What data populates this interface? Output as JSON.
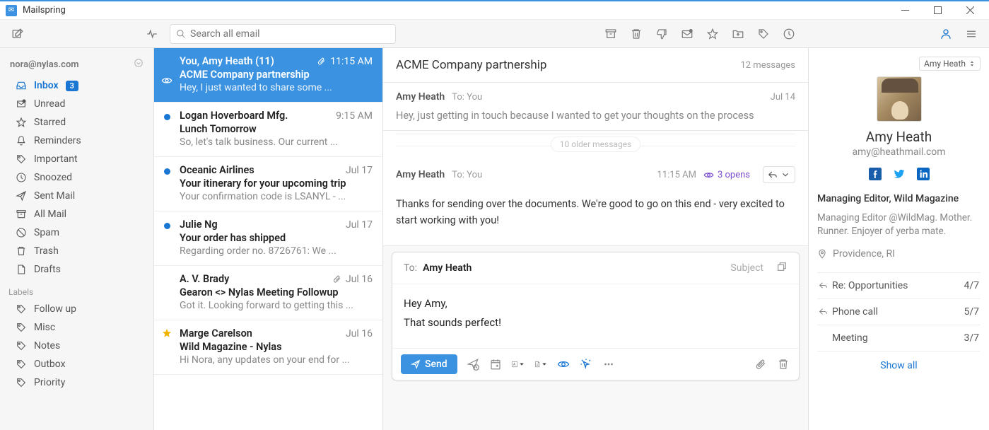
{
  "app": {
    "title": "Mailspring"
  },
  "toolbar": {
    "search_placeholder": "Search all email"
  },
  "sidebar": {
    "account": "nora@nylas.com",
    "inbox": {
      "label": "Inbox",
      "count": "3"
    },
    "items": [
      {
        "label": "Unread"
      },
      {
        "label": "Starred"
      },
      {
        "label": "Reminders"
      },
      {
        "label": "Important"
      },
      {
        "label": "Snoozed"
      },
      {
        "label": "Sent Mail"
      },
      {
        "label": "All Mail"
      },
      {
        "label": "Spam"
      },
      {
        "label": "Trash"
      },
      {
        "label": "Drafts"
      }
    ],
    "labels_header": "Labels",
    "labels": [
      {
        "label": "Follow up"
      },
      {
        "label": "Misc"
      },
      {
        "label": "Notes"
      },
      {
        "label": "Outbox"
      },
      {
        "label": "Priority"
      }
    ]
  },
  "messages": [
    {
      "from": "You, Amy Heath (11)",
      "time": "11:15 AM",
      "subject": "ACME Company partnership",
      "preview": "Hey, I just wanted to share some ...",
      "selected": true,
      "attach": true
    },
    {
      "from": "Logan Hoverboard Mfg.",
      "time": "9:15 AM",
      "subject": "Lunch Tomorrow",
      "preview": "So, let's talk business. Our current ...",
      "unread": true
    },
    {
      "from": "Oceanic Airlines",
      "time": "Jul 17",
      "subject": "Your itinerary for your upcoming trip",
      "preview": "Your confirmation code is LSANYL - ...",
      "unread": true
    },
    {
      "from": "Julie Ng",
      "time": "Jul 17",
      "subject": "Your order has shipped",
      "preview": "Regarding order no. 8726761: We ...",
      "unread": true
    },
    {
      "from": "A. V. Brady",
      "time": "Jul 16",
      "subject": "Gearon <> Nylas Meeting Followup",
      "preview": "Got it. Looking forward to getting this ...",
      "attach": true
    },
    {
      "from": "Marge Carelson",
      "time": "Jul 16",
      "subject": "Wild Magazine - Nylas",
      "preview": "Hi Nora, any updates on your end for ...",
      "star": true
    }
  ],
  "reader": {
    "subject": "ACME Company partnership",
    "count": "12 messages",
    "collapsed": {
      "sender": "Amy Heath",
      "to": "To:",
      "you": "You",
      "date": "Jul 14",
      "body": "Hey, just getting in touch because I wanted to get your thoughts on the process"
    },
    "older": "10 older messages",
    "full": {
      "sender": "Amy Heath",
      "to": "To:",
      "you": "You",
      "date": "11:15 AM",
      "opens": "3 opens",
      "body": "Thanks for sending over the documents. We're good to go on this end - very excited to start working with you!"
    }
  },
  "composer": {
    "to_label": "To:",
    "recipient": "Amy Heath",
    "subject_hint": "Subject",
    "body_line1": "Hey Amy,",
    "body_line2": "That sounds perfect!",
    "send": "Send"
  },
  "contact": {
    "dropdown": "Amy Heath",
    "name": "Amy Heath",
    "email": "amy@heathmail.com",
    "title": "Managing Editor, Wild Magazine",
    "bio": "Managing Editor @WildMag. Mother. Runner. Enjoyer of yerba mate.",
    "location": "Providence, RI",
    "related": [
      {
        "icon": "reply",
        "label": "Re: Opportunities",
        "meta": "4/7"
      },
      {
        "icon": "reply",
        "label": "Phone call",
        "meta": "5/7"
      },
      {
        "icon": "none",
        "label": "Meeting",
        "meta": "3/7"
      }
    ],
    "show_all": "Show all"
  }
}
